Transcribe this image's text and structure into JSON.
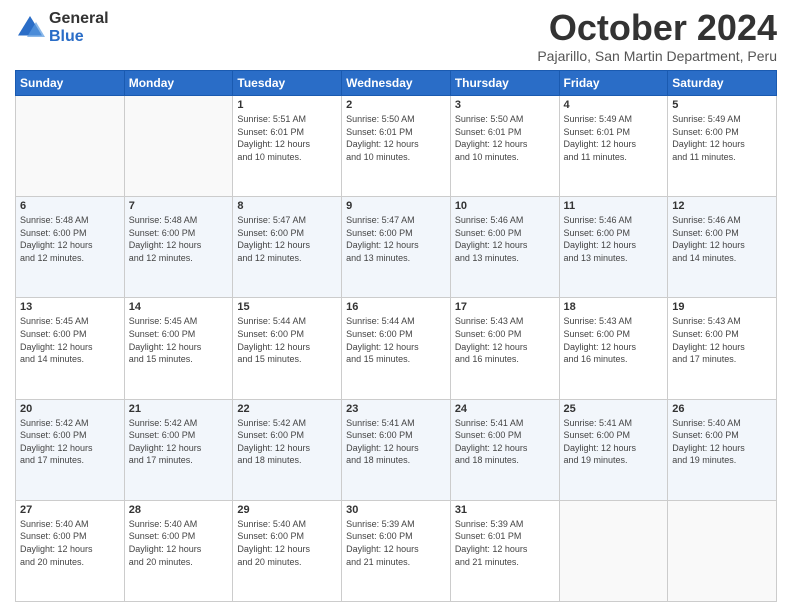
{
  "logo": {
    "general": "General",
    "blue": "Blue"
  },
  "header": {
    "month": "October 2024",
    "location": "Pajarillo, San Martin Department, Peru"
  },
  "days": {
    "headers": [
      "Sunday",
      "Monday",
      "Tuesday",
      "Wednesday",
      "Thursday",
      "Friday",
      "Saturday"
    ]
  },
  "weeks": [
    {
      "days": [
        {
          "num": "",
          "info": ""
        },
        {
          "num": "",
          "info": ""
        },
        {
          "num": "1",
          "info": "Sunrise: 5:51 AM\nSunset: 6:01 PM\nDaylight: 12 hours\nand 10 minutes."
        },
        {
          "num": "2",
          "info": "Sunrise: 5:50 AM\nSunset: 6:01 PM\nDaylight: 12 hours\nand 10 minutes."
        },
        {
          "num": "3",
          "info": "Sunrise: 5:50 AM\nSunset: 6:01 PM\nDaylight: 12 hours\nand 10 minutes."
        },
        {
          "num": "4",
          "info": "Sunrise: 5:49 AM\nSunset: 6:01 PM\nDaylight: 12 hours\nand 11 minutes."
        },
        {
          "num": "5",
          "info": "Sunrise: 5:49 AM\nSunset: 6:00 PM\nDaylight: 12 hours\nand 11 minutes."
        }
      ]
    },
    {
      "days": [
        {
          "num": "6",
          "info": "Sunrise: 5:48 AM\nSunset: 6:00 PM\nDaylight: 12 hours\nand 12 minutes."
        },
        {
          "num": "7",
          "info": "Sunrise: 5:48 AM\nSunset: 6:00 PM\nDaylight: 12 hours\nand 12 minutes."
        },
        {
          "num": "8",
          "info": "Sunrise: 5:47 AM\nSunset: 6:00 PM\nDaylight: 12 hours\nand 12 minutes."
        },
        {
          "num": "9",
          "info": "Sunrise: 5:47 AM\nSunset: 6:00 PM\nDaylight: 12 hours\nand 13 minutes."
        },
        {
          "num": "10",
          "info": "Sunrise: 5:46 AM\nSunset: 6:00 PM\nDaylight: 12 hours\nand 13 minutes."
        },
        {
          "num": "11",
          "info": "Sunrise: 5:46 AM\nSunset: 6:00 PM\nDaylight: 12 hours\nand 13 minutes."
        },
        {
          "num": "12",
          "info": "Sunrise: 5:46 AM\nSunset: 6:00 PM\nDaylight: 12 hours\nand 14 minutes."
        }
      ]
    },
    {
      "days": [
        {
          "num": "13",
          "info": "Sunrise: 5:45 AM\nSunset: 6:00 PM\nDaylight: 12 hours\nand 14 minutes."
        },
        {
          "num": "14",
          "info": "Sunrise: 5:45 AM\nSunset: 6:00 PM\nDaylight: 12 hours\nand 15 minutes."
        },
        {
          "num": "15",
          "info": "Sunrise: 5:44 AM\nSunset: 6:00 PM\nDaylight: 12 hours\nand 15 minutes."
        },
        {
          "num": "16",
          "info": "Sunrise: 5:44 AM\nSunset: 6:00 PM\nDaylight: 12 hours\nand 15 minutes."
        },
        {
          "num": "17",
          "info": "Sunrise: 5:43 AM\nSunset: 6:00 PM\nDaylight: 12 hours\nand 16 minutes."
        },
        {
          "num": "18",
          "info": "Sunrise: 5:43 AM\nSunset: 6:00 PM\nDaylight: 12 hours\nand 16 minutes."
        },
        {
          "num": "19",
          "info": "Sunrise: 5:43 AM\nSunset: 6:00 PM\nDaylight: 12 hours\nand 17 minutes."
        }
      ]
    },
    {
      "days": [
        {
          "num": "20",
          "info": "Sunrise: 5:42 AM\nSunset: 6:00 PM\nDaylight: 12 hours\nand 17 minutes."
        },
        {
          "num": "21",
          "info": "Sunrise: 5:42 AM\nSunset: 6:00 PM\nDaylight: 12 hours\nand 17 minutes."
        },
        {
          "num": "22",
          "info": "Sunrise: 5:42 AM\nSunset: 6:00 PM\nDaylight: 12 hours\nand 18 minutes."
        },
        {
          "num": "23",
          "info": "Sunrise: 5:41 AM\nSunset: 6:00 PM\nDaylight: 12 hours\nand 18 minutes."
        },
        {
          "num": "24",
          "info": "Sunrise: 5:41 AM\nSunset: 6:00 PM\nDaylight: 12 hours\nand 18 minutes."
        },
        {
          "num": "25",
          "info": "Sunrise: 5:41 AM\nSunset: 6:00 PM\nDaylight: 12 hours\nand 19 minutes."
        },
        {
          "num": "26",
          "info": "Sunrise: 5:40 AM\nSunset: 6:00 PM\nDaylight: 12 hours\nand 19 minutes."
        }
      ]
    },
    {
      "days": [
        {
          "num": "27",
          "info": "Sunrise: 5:40 AM\nSunset: 6:00 PM\nDaylight: 12 hours\nand 20 minutes."
        },
        {
          "num": "28",
          "info": "Sunrise: 5:40 AM\nSunset: 6:00 PM\nDaylight: 12 hours\nand 20 minutes."
        },
        {
          "num": "29",
          "info": "Sunrise: 5:40 AM\nSunset: 6:00 PM\nDaylight: 12 hours\nand 20 minutes."
        },
        {
          "num": "30",
          "info": "Sunrise: 5:39 AM\nSunset: 6:00 PM\nDaylight: 12 hours\nand 21 minutes."
        },
        {
          "num": "31",
          "info": "Sunrise: 5:39 AM\nSunset: 6:01 PM\nDaylight: 12 hours\nand 21 minutes."
        },
        {
          "num": "",
          "info": ""
        },
        {
          "num": "",
          "info": ""
        }
      ]
    }
  ]
}
